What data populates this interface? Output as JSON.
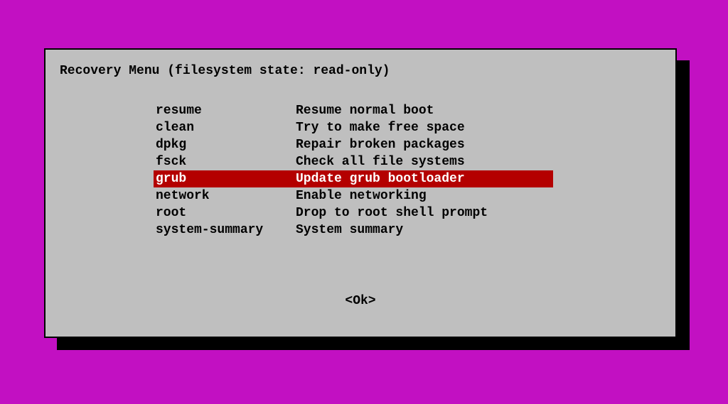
{
  "title": "Recovery Menu (filesystem state: read-only)",
  "selectedIndex": 4,
  "menuItems": [
    {
      "key": "resume",
      "desc": "Resume normal boot"
    },
    {
      "key": "clean",
      "desc": "Try to make free space"
    },
    {
      "key": "dpkg",
      "desc": "Repair broken packages"
    },
    {
      "key": "fsck",
      "desc": "Check all file systems"
    },
    {
      "key": "grub",
      "desc": "Update grub bootloader"
    },
    {
      "key": "network",
      "desc": "Enable networking"
    },
    {
      "key": "root",
      "desc": "Drop to root shell prompt"
    },
    {
      "key": "system-summary",
      "desc": "System summary"
    }
  ],
  "okButton": "<Ok>"
}
